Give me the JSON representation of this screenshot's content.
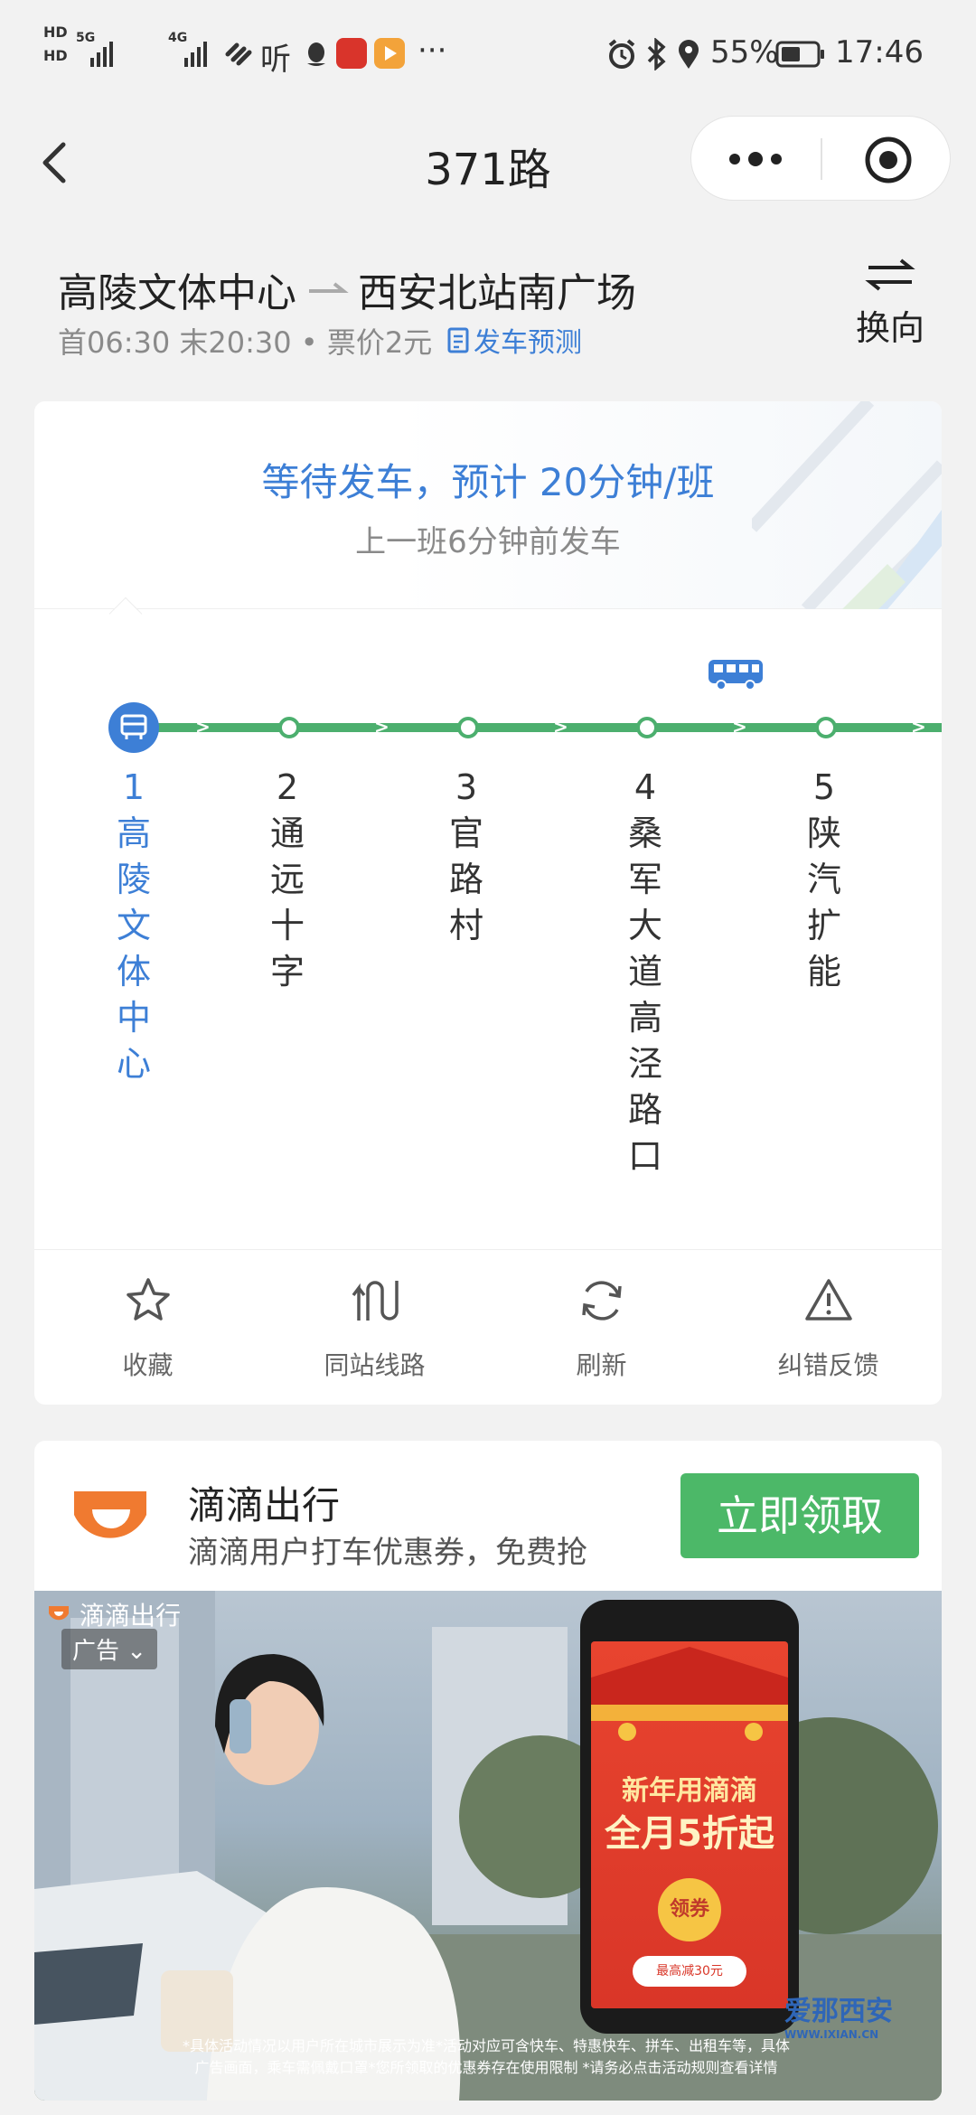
{
  "status_bar": {
    "hd1": "HD",
    "hd2": "HD",
    "net1": "5G",
    "net2": "4G",
    "listen_icon_text": "听",
    "more": "···",
    "battery": "55%",
    "time": "17:46"
  },
  "header": {
    "title": "371路"
  },
  "route": {
    "from": "高陵文体中心",
    "to": "西安北站南广场",
    "schedule": "首06:30 末20:30 • 票价2元",
    "forecast_label": "发车预测",
    "reverse_label": "换向"
  },
  "status": {
    "wait_title": "等待发车，预计 20分钟/班",
    "wait_sub": "上一班6分钟前发车"
  },
  "stops": [
    {
      "num": "1",
      "chars": [
        "高",
        "陵",
        "文",
        "体",
        "中",
        "心"
      ],
      "active": true
    },
    {
      "num": "2",
      "chars": [
        "通",
        "远",
        "十",
        "字"
      ],
      "active": false
    },
    {
      "num": "3",
      "chars": [
        "官",
        "路",
        "村"
      ],
      "active": false
    },
    {
      "num": "4",
      "chars": [
        "桑",
        "军",
        "大",
        "道",
        "高",
        "泾",
        "路",
        "口"
      ],
      "active": false
    },
    {
      "num": "5",
      "chars": [
        "陕",
        "汽",
        "扩",
        "能"
      ],
      "active": false
    }
  ],
  "actions": {
    "favorite": "收藏",
    "same_station": "同站线路",
    "refresh": "刷新",
    "feedback": "纠错反馈"
  },
  "ad": {
    "name": "滴滴出行",
    "description": "滴滴用户打车优惠券，免费抢",
    "cta": "立即领取",
    "brand_small": "滴滴出行",
    "tag": "广告",
    "promo_title": "新年用滴滴",
    "promo_big": "全月5折起",
    "promo_coupon": "领券",
    "promo_max": "最高减30元",
    "disclaimer_1": "*具体活动情况以用户所在城市展示为准*活动对应可含快车、特惠快车、拼车、出租车等，具体",
    "disclaimer_2": "广告画面，乘车需佩戴口罩*您所领取的优惠券存在使用限制 *请务必点击活动规则查看详情",
    "watermark": "爱那西安",
    "watermark_url": "WWW.IXIAN.CN"
  },
  "colors": {
    "accent_blue": "#3d7fd6",
    "line_green": "#4caf6e",
    "cta_green": "#4cb868",
    "didi_orange": "#f07a30"
  }
}
